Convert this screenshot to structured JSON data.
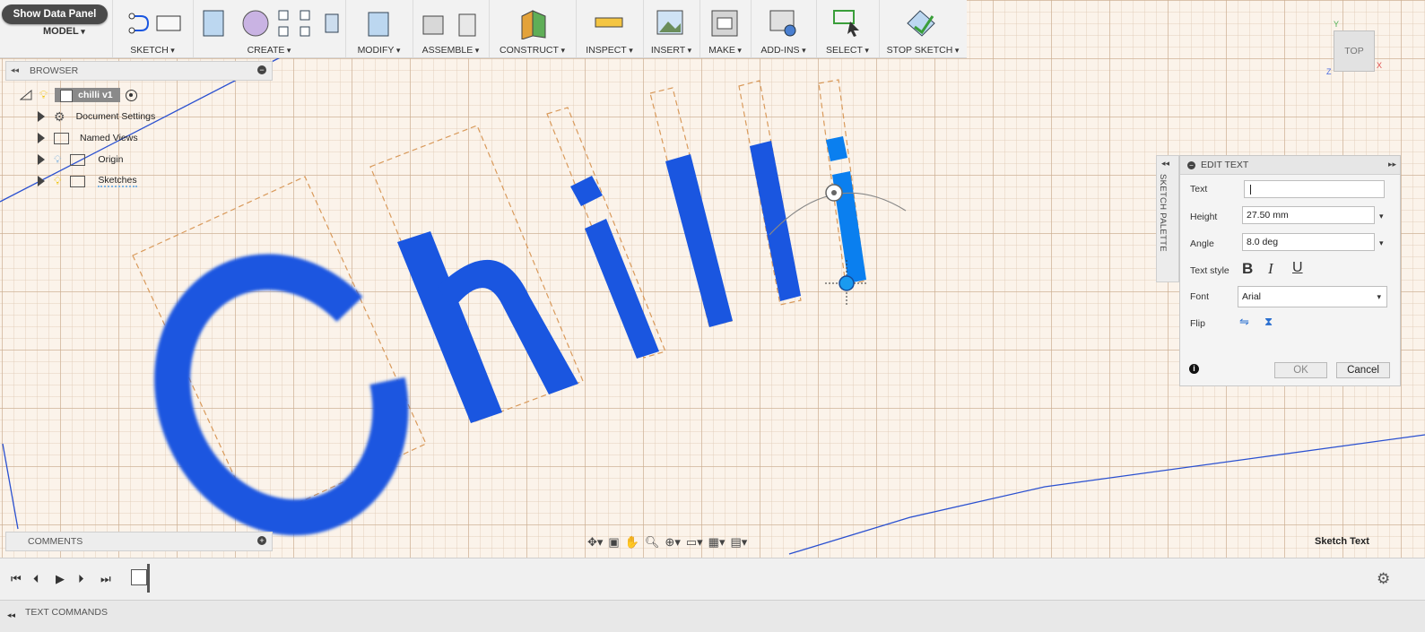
{
  "app": {
    "data_panel_label": "Show Data Panel",
    "workspace_label": "MODEL",
    "status_text": "Sketch Text"
  },
  "toolbar": {
    "groups": [
      {
        "label": "SKETCH"
      },
      {
        "label": "CREATE"
      },
      {
        "label": "MODIFY"
      },
      {
        "label": "ASSEMBLE"
      },
      {
        "label": "CONSTRUCT"
      },
      {
        "label": "INSPECT"
      },
      {
        "label": "INSERT"
      },
      {
        "label": "MAKE"
      },
      {
        "label": "ADD-INS"
      },
      {
        "label": "SELECT"
      },
      {
        "label": "STOP SKETCH"
      }
    ]
  },
  "browser": {
    "title": "BROWSER",
    "root": "chilli v1",
    "items": [
      {
        "label": "Document Settings",
        "icon": "gear-icon"
      },
      {
        "label": "Named Views",
        "icon": "folder-icon"
      },
      {
        "label": "Origin",
        "icon": "folder-icon"
      },
      {
        "label": "Sketches",
        "icon": "folder-icon"
      }
    ]
  },
  "comments": {
    "title": "COMMENTS"
  },
  "sketch": {
    "text": "Chilli"
  },
  "sketch_palette": {
    "label": "SKETCH PALETTE"
  },
  "edit_text": {
    "title": "EDIT TEXT",
    "text_label": "Text",
    "text_value": "",
    "height_label": "Height",
    "height_value": "27.50 mm",
    "angle_label": "Angle",
    "angle_value": "8.0 deg",
    "style_label": "Text style",
    "bold": "B",
    "italic": "I",
    "underline": "U",
    "font_label": "Font",
    "font_value": "Arial",
    "flip_label": "Flip",
    "ok_label": "OK",
    "cancel_label": "Cancel"
  },
  "viewcube": {
    "face": "TOP",
    "axis_y": "Y",
    "axis_x": "X",
    "axis_z": "Z"
  },
  "bottom": {
    "text_commands": "TEXT COMMANDS"
  },
  "colors": {
    "accent_blue": "#1a56e0",
    "select_blue": "#0a84ff",
    "dash_orange": "#d99a5b"
  }
}
